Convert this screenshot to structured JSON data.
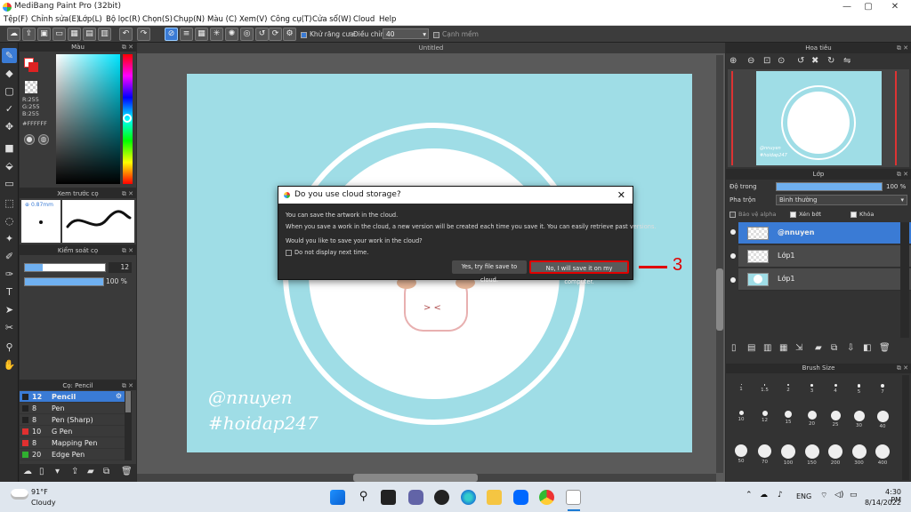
{
  "window": {
    "title": "MediBang Paint Pro (32bit)",
    "minimize": "—",
    "maximize": "▢",
    "close": "✕"
  },
  "menu": [
    "Tệp(F)",
    "Chỉnh sửa(E)",
    "Lớp(L)",
    "Bộ lọc(R)",
    "Chọn(S)",
    "Chụp(N)",
    "Màu (C)",
    "Xem(V)",
    "Công cụ(T)",
    "Cửa sổ(W)",
    "Cloud",
    "Help"
  ],
  "toolbar": {
    "antialias_label": "Khử răng cưa",
    "adjust_label": "Điều chỉnh",
    "adjust_value": "40",
    "smooth_label": "Cạnh mềm"
  },
  "color_panel": {
    "title": "Màu",
    "r": "R:255",
    "g": "G:255",
    "b": "B:255",
    "hex": "#FFFFFF"
  },
  "preview_panel": {
    "title": "Xem trước cọ",
    "size": "0.87mm"
  },
  "brush_control": {
    "title": "Kiểm soát cọ",
    "size": "12",
    "opacity": "100 %"
  },
  "brush_list": {
    "title": "Cọ: Pencil",
    "items": [
      {
        "size": "12",
        "name": "Pencil",
        "color": "#222222"
      },
      {
        "size": "8",
        "name": "Pen",
        "color": "#222222"
      },
      {
        "size": "8",
        "name": "Pen (Sharp)",
        "color": "#222222"
      },
      {
        "size": "10",
        "name": "G Pen",
        "color": "#e03030"
      },
      {
        "size": "8",
        "name": "Mapping Pen",
        "color": "#e03030"
      },
      {
        "size": "20",
        "name": "Edge Pen",
        "color": "#30b030"
      }
    ]
  },
  "document": {
    "tab": "Untitled",
    "watermark_1": "@nnuyen",
    "watermark_2": "#hoidap247"
  },
  "dialog": {
    "title": "Do you use cloud storage?",
    "line1": "You can save the artwork in the cloud.",
    "line2": "When you save a work in the cloud, a new version will be created each time you save it. You can easily retrieve past versions.",
    "line3": "Would you like to save your work in the cloud?",
    "checkbox": "Do not display next time.",
    "btn_yes": "Yes, try file save to cloud.",
    "btn_no": "No, I will save it on my computer."
  },
  "annotation": "3",
  "navigator": {
    "title": "Hoa tiêu",
    "thumb_text_1": "@nnuyen",
    "thumb_text_2": "#hoidap247"
  },
  "layers": {
    "title": "Lớp",
    "opacity_label": "Độ trong",
    "opacity_value": "100 %",
    "opacity_fraction": 1.0,
    "blend_label": "Pha trộn",
    "blend_value": "Bình thường",
    "protect_alpha": "Bảo vệ alpha",
    "clip": "Xén bớt",
    "lock": "Khóa",
    "items": [
      {
        "name": "@nnuyen",
        "selected": true
      },
      {
        "name": "Lớp1",
        "selected": false
      },
      {
        "name": "Lớp1",
        "selected": false
      }
    ]
  },
  "brush_size": {
    "title": "Brush Size",
    "sizes": [
      "1",
      "1.5",
      "2",
      "3",
      "4",
      "5",
      "7",
      "10",
      "12",
      "15",
      "20",
      "25",
      "30",
      "40",
      "50",
      "70",
      "100",
      "150",
      "200",
      "300",
      "400"
    ]
  },
  "taskbar": {
    "temp": "91°F",
    "weather": "Cloudy",
    "lang": "ENG",
    "time": "4:30 PM",
    "date": "8/14/2022"
  }
}
